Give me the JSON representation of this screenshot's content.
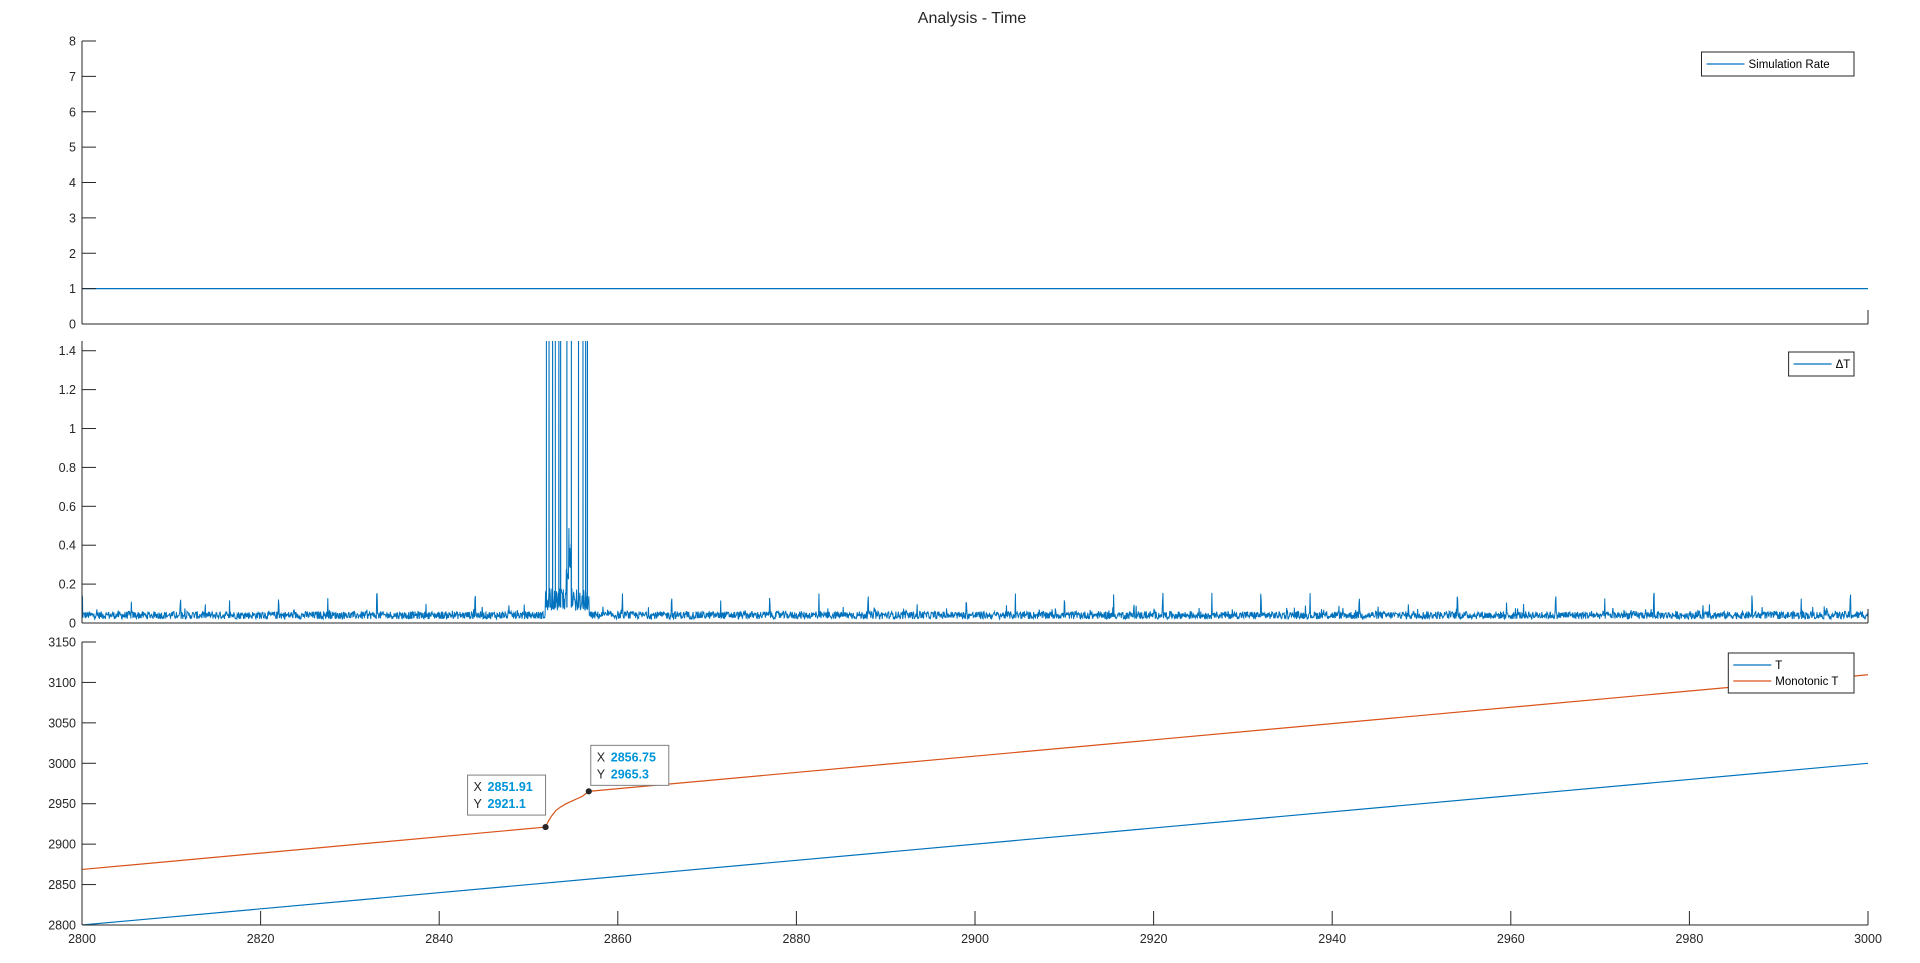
{
  "figure_title": "Analysis - Time",
  "colors": {
    "blue": "#0072BD",
    "orange": "#D95319",
    "axis": "#262626",
    "datatip_value": "#0095D9"
  },
  "chart_data": [
    {
      "type": "line",
      "title": "Analysis - Time",
      "xlim": [
        2800,
        3000
      ],
      "ylim": [
        0,
        8
      ],
      "yticks": [
        0,
        1,
        2,
        3,
        4,
        5,
        6,
        7,
        8
      ],
      "xticks": [],
      "grid": false,
      "legend_position": "top-right",
      "series": [
        {
          "name": "Simulation Rate",
          "color": "#0072BD",
          "x": [
            2800,
            3000
          ],
          "y": [
            1,
            1
          ]
        }
      ]
    },
    {
      "type": "line",
      "title": "",
      "xlim": [
        2800,
        3000
      ],
      "ylim": [
        0,
        1.45
      ],
      "yticks": [
        0,
        0.2,
        0.4,
        0.6,
        0.8,
        1,
        1.2,
        1.4
      ],
      "xticks": [],
      "grid": false,
      "legend_position": "top-right",
      "series": [
        {
          "name": "ΔT",
          "color": "#0072BD",
          "baseline_range": [
            0.02,
            0.06
          ],
          "periodic_spike_interval": 5.5,
          "periodic_spike_height": 0.13,
          "burst": {
            "x_range": [
              2851.9,
              2856.8
            ],
            "spike_x": [
              2852.0,
              2852.3,
              2852.7,
              2853.0,
              2853.4,
              2853.6,
              2854.3,
              2854.8,
              2855.6,
              2856.1,
              2856.4,
              2856.6
            ],
            "inner_peak": {
              "x": 2854.5,
              "y": 0.55
            }
          }
        }
      ]
    },
    {
      "type": "line",
      "title": "",
      "xlim": [
        2800,
        3000
      ],
      "ylim": [
        2800,
        3150
      ],
      "yticks": [
        2800,
        2850,
        2900,
        2950,
        3000,
        3050,
        3100,
        3150
      ],
      "xticks": [
        2800,
        2820,
        2840,
        2860,
        2880,
        2900,
        2920,
        2940,
        2960,
        2980,
        3000
      ],
      "grid": false,
      "legend_position": "top-right",
      "series": [
        {
          "name": "T",
          "color": "#0072BD",
          "x": [
            2800,
            3000
          ],
          "y": [
            2800,
            3000
          ]
        },
        {
          "name": "Monotonic T",
          "color": "#D95319",
          "x": [
            2800,
            2851.91,
            2852.2,
            2852.6,
            2853.1,
            2853.6,
            2854.2,
            2854.8,
            2855.4,
            2856.0,
            2856.75,
            3000
          ],
          "y": [
            2868.7,
            2921.1,
            2928,
            2935,
            2942,
            2946,
            2950,
            2953,
            2956,
            2959,
            2965.3,
            3109.5
          ]
        }
      ],
      "datatips": [
        {
          "x_label": "X",
          "y_label": "Y",
          "x_text": "2851.91",
          "y_text": "2921.1",
          "x": 2851.91,
          "y": 2921.1,
          "side": "left"
        },
        {
          "x_label": "X",
          "y_label": "Y",
          "x_text": "2856.75",
          "y_text": "2965.3",
          "x": 2856.75,
          "y": 2965.3,
          "side": "right"
        }
      ]
    }
  ]
}
